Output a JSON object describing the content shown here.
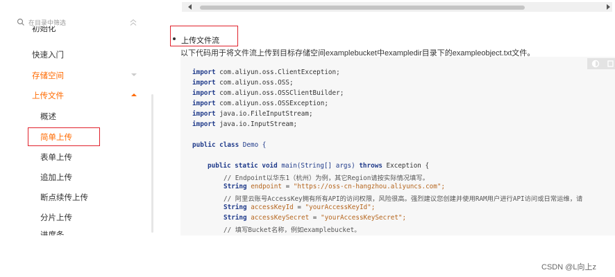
{
  "sidebar": {
    "search_placeholder": "在目录中筛选",
    "items": [
      {
        "label": "快速入门"
      },
      {
        "label": "存储空间"
      },
      {
        "label": "上传文件"
      },
      {
        "label": "概述"
      },
      {
        "label": "简单上传"
      },
      {
        "label": "表单上传"
      },
      {
        "label": "追加上传"
      },
      {
        "label": "断点续传上传"
      },
      {
        "label": "分片上传"
      }
    ],
    "clipped_top_label": "初始化",
    "clipped_bottom_label": "进度条"
  },
  "content": {
    "section_title": "上传文件流",
    "description": "以下代码用于将文件流上传到目标存储空间examplebucket中exampledir目录下的exampleobject.txt文件。"
  },
  "code": {
    "imports": [
      {
        "kw": "import",
        "pkg": "com.aliyun.oss.ClientException;"
      },
      {
        "kw": "import",
        "pkg": "com.aliyun.oss.OSS;"
      },
      {
        "kw": "import",
        "pkg": "com.aliyun.oss.OSSClientBuilder;"
      },
      {
        "kw": "import",
        "pkg": "com.aliyun.oss.OSSException;"
      },
      {
        "kw": "import",
        "pkg": "java.io.FileInputStream;"
      },
      {
        "kw": "import",
        "pkg": "java.io.InputStream;"
      }
    ],
    "class_kw": "public class",
    "class_name": "Demo {",
    "main_kw1": "public static void",
    "main_sig": "main(String[] args)",
    "main_kw2": "throws",
    "main_exc": "Exception {",
    "comment_endpoint": "// Endpoint以华东1（杭州）为例，其它Region请按实际情况填写。",
    "endpoint_type": "String",
    "endpoint_var": "endpoint",
    "endpoint_eq": " = ",
    "endpoint_val": "\"https://oss-cn-hangzhou.aliyuncs.com\";",
    "comment_key": "// 阿里云账号AccessKey拥有所有API的访问权限，风险很高。强烈建议您创建并使用RAM用户进行API访问或日常运维，请",
    "keyid_type": "String",
    "keyid_var": "accessKeyId",
    "keyid_eq": " = ",
    "keyid_val": "\"yourAccessKeyId\";",
    "secret_type": "String",
    "secret_var": "accessKeySecret",
    "secret_eq": " = ",
    "secret_val": "\"yourAccessKeySecret\";",
    "comment_bucket": "// 填写Bucket名称，例如examplebucket。"
  },
  "watermark": "CSDN @L向上z",
  "colors": {
    "accent": "#ff6a00",
    "highlight": "#e0202a",
    "keyword": "#1f3a8a",
    "string": "#b5651d"
  }
}
